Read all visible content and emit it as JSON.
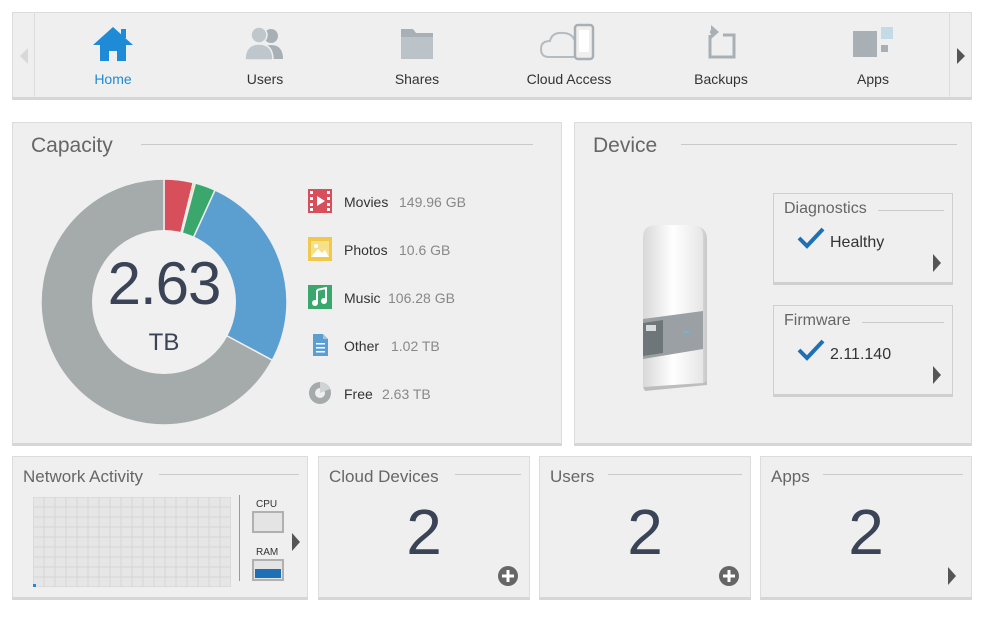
{
  "nav": {
    "items": [
      {
        "label": "Home",
        "icon": "home-icon",
        "active": true
      },
      {
        "label": "Users",
        "icon": "users-icon",
        "active": false
      },
      {
        "label": "Shares",
        "icon": "folder-icon",
        "active": false
      },
      {
        "label": "Cloud Access",
        "icon": "cloud-device-icon",
        "active": false
      },
      {
        "label": "Backups",
        "icon": "backup-icon",
        "active": false
      },
      {
        "label": "Apps",
        "icon": "apps-icon",
        "active": false
      }
    ]
  },
  "capacity": {
    "title": "Capacity",
    "total_value": "2.63",
    "total_unit": "TB",
    "legend": [
      {
        "name": "Movies",
        "value": "149.96 GB",
        "icon": "film-icon",
        "color": "#d64f5b"
      },
      {
        "name": "Photos",
        "value": "10.6 GB",
        "icon": "photo-icon",
        "color": "#f1c94a"
      },
      {
        "name": "Music",
        "value": "106.28 GB",
        "icon": "music-icon",
        "color": "#3aa76d"
      },
      {
        "name": "Other",
        "value": "1.02 TB",
        "icon": "document-icon",
        "color": "#5b9fd1"
      },
      {
        "name": "Free",
        "value": "2.63 TB",
        "icon": "pie-icon",
        "color": "#a5abab"
      }
    ]
  },
  "device": {
    "title": "Device",
    "diagnostics": {
      "title": "Diagnostics",
      "value": "Healthy"
    },
    "firmware": {
      "title": "Firmware",
      "value": "2.11.140"
    }
  },
  "network": {
    "title": "Network Activity",
    "cpu_label": "CPU",
    "ram_label": "RAM"
  },
  "cloud_devices": {
    "title": "Cloud Devices",
    "count": "2"
  },
  "users": {
    "title": "Users",
    "count": "2"
  },
  "apps": {
    "title": "Apps",
    "count": "2"
  },
  "colors": {
    "accent": "#1f8ad6",
    "number": "#3a4456",
    "panel": "#efefef"
  }
}
